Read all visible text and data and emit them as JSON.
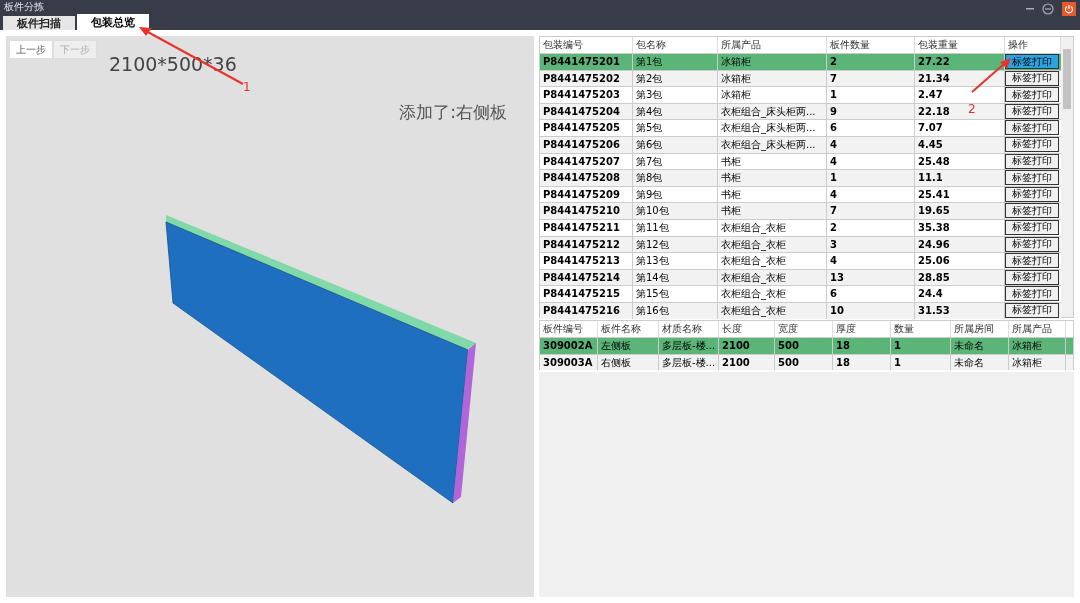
{
  "window": {
    "title": "板件分拣"
  },
  "tabs": [
    {
      "label": "板件扫描",
      "selected": false
    },
    {
      "label": "包装总览",
      "selected": true
    }
  ],
  "viewer": {
    "buttons": [
      {
        "label": "上一步",
        "disabled": false
      },
      {
        "label": "下一步",
        "disabled": true
      }
    ],
    "dimensions": "2100*500*36",
    "message": "添加了:右侧板"
  },
  "packages_table": {
    "columns": [
      "包装编号",
      "包名称",
      "所属产品",
      "板件数量",
      "包装重量",
      "操作"
    ],
    "rows": [
      {
        "cells": [
          "P8441475201",
          "第1包",
          "冰箱柜",
          "2",
          "27.22"
        ],
        "action": "标签打印",
        "selected": true
      },
      {
        "cells": [
          "P8441475202",
          "第2包",
          "冰箱柜",
          "7",
          "21.34"
        ],
        "action": "标签打印",
        "selected": false
      },
      {
        "cells": [
          "P8441475203",
          "第3包",
          "冰箱柜",
          "1",
          "2.47"
        ],
        "action": "标签打印",
        "selected": false
      },
      {
        "cells": [
          "P8441475204",
          "第4包",
          "衣柜组合_床头柜两...",
          "9",
          "22.18"
        ],
        "action": "标签打印",
        "selected": false
      },
      {
        "cells": [
          "P8441475205",
          "第5包",
          "衣柜组合_床头柜两...",
          "6",
          "7.07"
        ],
        "action": "标签打印",
        "selected": false
      },
      {
        "cells": [
          "P8441475206",
          "第6包",
          "衣柜组合_床头柜两...",
          "4",
          "4.45"
        ],
        "action": "标签打印",
        "selected": false
      },
      {
        "cells": [
          "P8441475207",
          "第7包",
          "书柜",
          "4",
          "25.48"
        ],
        "action": "标签打印",
        "selected": false
      },
      {
        "cells": [
          "P8441475208",
          "第8包",
          "书柜",
          "1",
          "11.1"
        ],
        "action": "标签打印",
        "selected": false
      },
      {
        "cells": [
          "P8441475209",
          "第9包",
          "书柜",
          "4",
          "25.41"
        ],
        "action": "标签打印",
        "selected": false
      },
      {
        "cells": [
          "P8441475210",
          "第10包",
          "书柜",
          "7",
          "19.65"
        ],
        "action": "标签打印",
        "selected": false
      },
      {
        "cells": [
          "P8441475211",
          "第11包",
          "衣柜组合_衣柜",
          "2",
          "35.38"
        ],
        "action": "标签打印",
        "selected": false
      },
      {
        "cells": [
          "P8441475212",
          "第12包",
          "衣柜组合_衣柜",
          "3",
          "24.96"
        ],
        "action": "标签打印",
        "selected": false
      },
      {
        "cells": [
          "P8441475213",
          "第13包",
          "衣柜组合_衣柜",
          "4",
          "25.06"
        ],
        "action": "标签打印",
        "selected": false
      },
      {
        "cells": [
          "P8441475214",
          "第14包",
          "衣柜组合_衣柜",
          "13",
          "28.85"
        ],
        "action": "标签打印",
        "selected": false
      },
      {
        "cells": [
          "P8441475215",
          "第15包",
          "衣柜组合_衣柜",
          "6",
          "24.4"
        ],
        "action": "标签打印",
        "selected": false
      },
      {
        "cells": [
          "P8441475216",
          "第16包",
          "衣柜组合_衣柜",
          "10",
          "31.53"
        ],
        "action": "标签打印",
        "selected": false
      }
    ]
  },
  "parts_table": {
    "columns": [
      "板件编号",
      "板件名称",
      "材质名称",
      "长度",
      "宽度",
      "厚度",
      "数量",
      "所属房间",
      "所属产品"
    ],
    "rows": [
      {
        "cells": [
          "309002A",
          "左侧板",
          "多层板-楼...",
          "2100",
          "500",
          "18",
          "1",
          "未命名",
          "冰箱柜"
        ],
        "selected": true
      },
      {
        "cells": [
          "309003A",
          "右侧板",
          "多层板-楼...",
          "2100",
          "500",
          "18",
          "1",
          "未命名",
          "冰箱柜"
        ],
        "selected": false
      }
    ]
  },
  "annotations": [
    {
      "label": "1"
    },
    {
      "label": "2"
    }
  ]
}
